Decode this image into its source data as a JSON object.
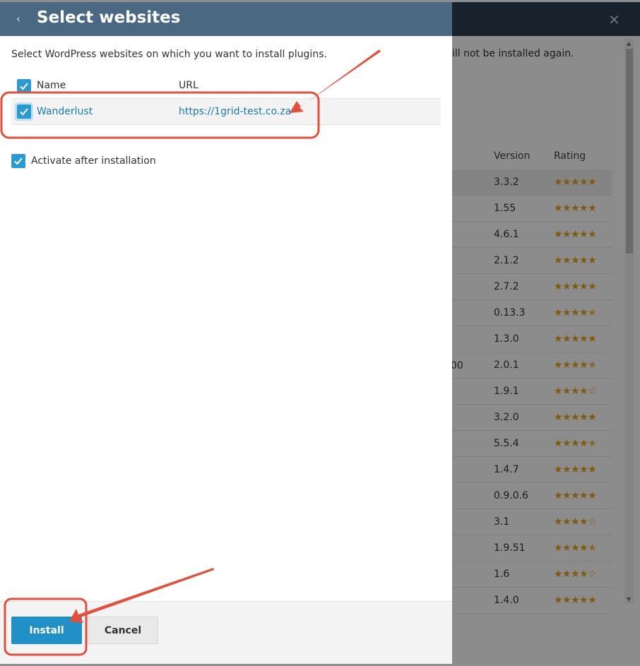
{
  "background": {
    "description_fragment": "ill not be installed again.",
    "partial_cell": "00",
    "columns": {
      "version": "Version",
      "rating": "Rating"
    },
    "rows": [
      {
        "version": "3.3.2",
        "rating": 5.0
      },
      {
        "version": "1.55",
        "rating": 5.0
      },
      {
        "version": "4.6.1",
        "rating": 5.0
      },
      {
        "version": "2.1.2",
        "rating": 5.0
      },
      {
        "version": "2.7.2",
        "rating": 5.0
      },
      {
        "version": "0.13.3",
        "rating": 4.5
      },
      {
        "version": "1.3.0",
        "rating": 5.0
      },
      {
        "version": "2.0.1",
        "rating": 4.5
      },
      {
        "version": "1.9.1",
        "rating": 4.0
      },
      {
        "version": "3.2.0",
        "rating": 5.0
      },
      {
        "version": "5.5.4",
        "rating": 4.5
      },
      {
        "version": "1.4.7",
        "rating": 5.0
      },
      {
        "version": "0.9.0.6",
        "rating": 5.0
      },
      {
        "version": "3.1",
        "rating": 4.0
      },
      {
        "version": "1.9.51",
        "rating": 4.5
      },
      {
        "version": "1.6",
        "rating": 4.0
      },
      {
        "version": "1.4.0",
        "rating": 5.0
      }
    ]
  },
  "modal": {
    "title": "Select websites",
    "description": "Select WordPress websites on which you want to install plugins.",
    "columns": {
      "name": "Name",
      "url": "URL"
    },
    "sites": [
      {
        "name": "Wanderlust",
        "url": "https://1grid-test.co.za",
        "checked": true
      }
    ],
    "activate_label": "Activate after installation",
    "install_label": "Install",
    "cancel_label": "Cancel"
  },
  "icons": {
    "back": "chevron-left-icon",
    "close": "close-icon",
    "check": "check-icon",
    "star": "star-icon"
  },
  "colors": {
    "header": "#4a6882",
    "checkbox": "#2b9ad1",
    "link": "#1b7bb3",
    "primary_button": "#2090c6",
    "annotation": "#e0503c",
    "star": "#e8a317"
  }
}
